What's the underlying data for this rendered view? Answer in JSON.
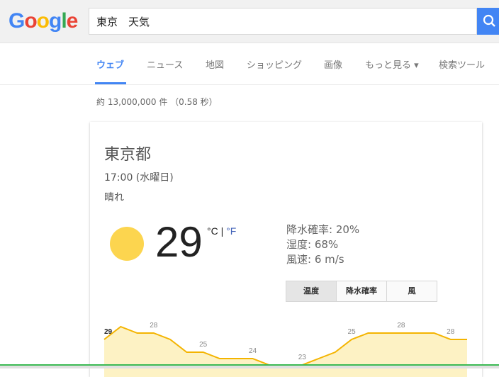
{
  "search": {
    "query": "東京　天気"
  },
  "tabs": [
    "ウェブ",
    "ニュース",
    "地図",
    "ショッピング",
    "画像",
    "もっと見る ▾",
    "検索ツール"
  ],
  "stats": "約 13,000,000 件 （0.58 秒）",
  "weather": {
    "location": "東京都",
    "time": "17:00 (水曜日)",
    "condition": "晴れ",
    "temperature": "29",
    "unit_c": "°C",
    "unit_sep": "|",
    "unit_f": "°F",
    "precip": "降水確率: 20%",
    "humidity": "湿度: 68%",
    "wind": "風速: 6 m/s",
    "buttons": [
      "温度",
      "降水確率",
      "風"
    ]
  },
  "colors": {
    "accent": "#4285f4",
    "sun": "#fcd54f",
    "chart_line": "#f4b400",
    "chart_fill": "#fdf2c4"
  },
  "chart_data": {
    "type": "area",
    "values": [
      27,
      29,
      28,
      28,
      27,
      25,
      25,
      24,
      24,
      24,
      23,
      23,
      23,
      24,
      25,
      27,
      28,
      28,
      28,
      28,
      28,
      27,
      27
    ],
    "labels": [
      {
        "i": 0,
        "v": "29"
      },
      {
        "i": 3,
        "v": "28"
      },
      {
        "i": 6,
        "v": "25"
      },
      {
        "i": 9,
        "v": "24"
      },
      {
        "i": 12,
        "v": "23"
      },
      {
        "i": 15,
        "v": "25"
      },
      {
        "i": 18,
        "v": "28"
      },
      {
        "i": 21,
        "v": "28"
      }
    ],
    "ylim": [
      22,
      30
    ]
  }
}
